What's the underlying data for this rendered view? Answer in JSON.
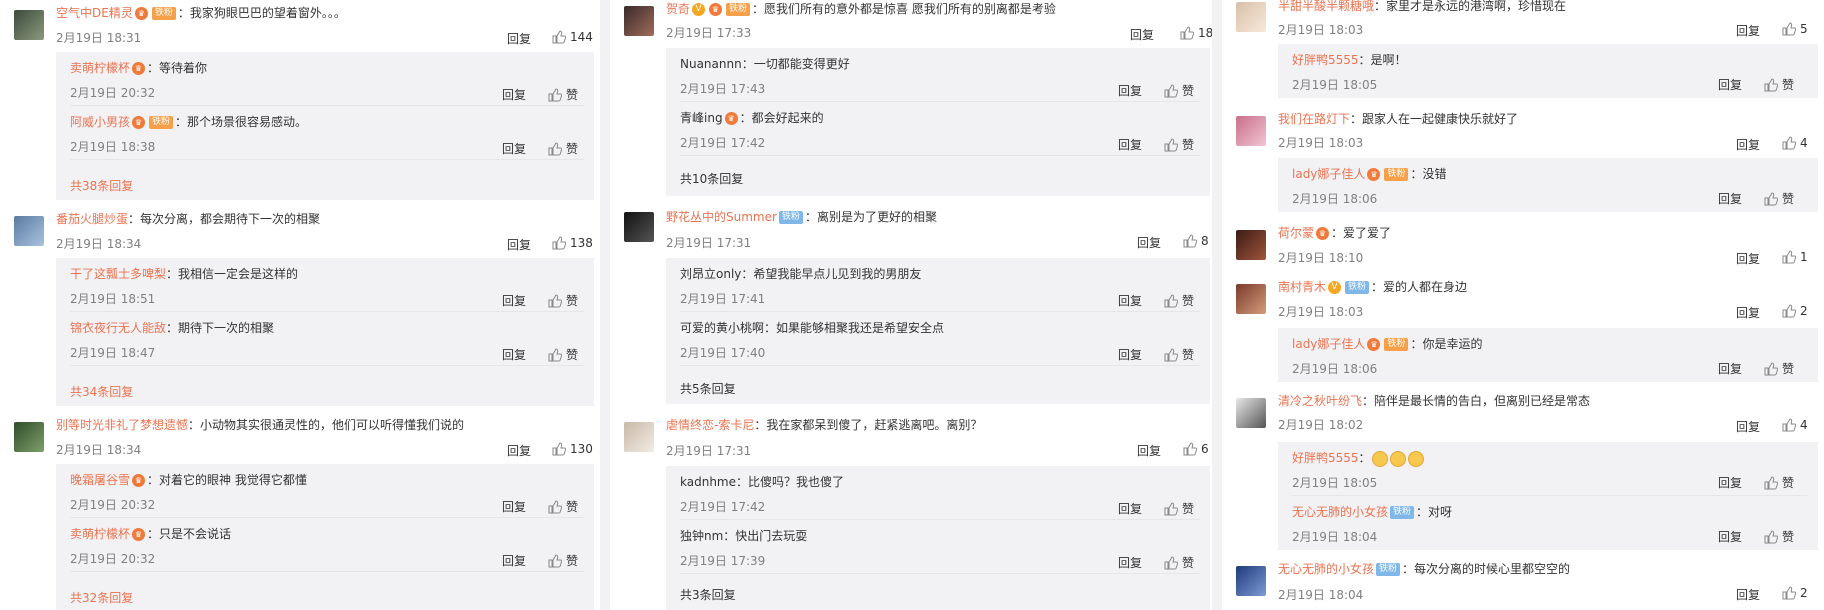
{
  "reply_label": "回复",
  "like_label": "赞",
  "colors": {
    "username": "#eb7350",
    "date": "#808080",
    "background": "#f2f2f5"
  },
  "icons": {
    "like": "thumbs-up-icon",
    "vip": "v-badge-icon",
    "fan": "fan-badge-icon"
  },
  "col1": {
    "c1": {
      "user": "空气中DE精灵",
      "badge": "铁粉",
      "text": "：我家狗眼巴巴的望着窗外。。。",
      "date": "2月19日 18:31",
      "likes": "144",
      "subs": [
        {
          "user": "卖萌柠檬杯",
          "text": "：等待着你",
          "date": "2月19日 20:32"
        },
        {
          "user": "阿威小男孩",
          "badge": "铁粉",
          "text": "：那个场景很容易感动。",
          "date": "2月19日 18:38"
        }
      ],
      "more": "共38条回复"
    },
    "c2": {
      "user": "番茄火腿炒蛋",
      "text": "：每次分离，都会期待下一次的相聚",
      "date": "2月19日 18:34",
      "likes": "138",
      "subs": [
        {
          "user": "干了这瓢士多啤梨",
          "text": "：我相信一定会是这样的",
          "date": "2月19日 18:51"
        },
        {
          "user": "锦衣夜行无人能敌",
          "text": "：期待下一次的相聚",
          "date": "2月19日 18:47"
        }
      ],
      "more": "共34条回复"
    },
    "c3": {
      "user": "别等时光非礼了梦想遗憾",
      "text": "：小动物其实很通灵性的，他们可以听得懂我们说的",
      "date": "2月19日 18:34",
      "likes": "130",
      "subs": [
        {
          "user": "晚霜屠谷雪",
          "text": "：对着它的眼神 我觉得它都懂",
          "date": "2月19日 20:32"
        },
        {
          "user": "卖萌柠檬杯",
          "text": "：只是不会说话",
          "date": "2月19日 20:32"
        }
      ],
      "more": "共32条回复"
    }
  },
  "col2": {
    "c1": {
      "user": "贺奇",
      "badge": "铁粉",
      "text": "：愿我们所有的意外都是惊喜  愿我们所有的别离都是考验",
      "date": "2月19日 17:33",
      "likes": "18",
      "subs": [
        {
          "user": "Nuanannn",
          "text": "：一切都能变得更好",
          "date": "2月19日 17:43"
        },
        {
          "user": "青峰ing",
          "text": "：都会好起来的",
          "date": "2月19日 17:42"
        }
      ],
      "more": "共10条回复"
    },
    "c2": {
      "user": "野花丛中的Summer",
      "badge": "铁粉",
      "text": "：离别是为了更好的相聚",
      "date": "2月19日 17:31",
      "likes": "8",
      "subs": [
        {
          "user": "刘昂立only",
          "text": "：希望我能早点儿见到我的男朋友",
          "date": "2月19日 17:41"
        },
        {
          "user": "可爱的黄小桃啊",
          "text": "：如果能够相聚我还是希望安全点",
          "date": "2月19日 17:40"
        }
      ],
      "more": "共5条回复"
    },
    "c3": {
      "user": "虐情终恋-索卡尼",
      "text": "：我在家都呆到傻了，赶紧逃离吧。离别？",
      "date": "2月19日 17:31",
      "likes": "6",
      "subs": [
        {
          "user": "kadnhme",
          "text": "：比傻吗？我也傻了",
          "date": "2月19日 17:42"
        },
        {
          "user": "独钟nm",
          "text": "：快出门去玩耍",
          "date": "2月19日 17:39"
        }
      ],
      "more": "共3条回复"
    }
  },
  "col3": {
    "c1": {
      "user": "半甜半酸半颗糖哦",
      "text": "：家里才是永远的港湾啊，珍惜现在",
      "date": "2月19日 18:03",
      "likes": "5",
      "subs": [
        {
          "user": "好胖鸭5555",
          "text": "：是啊！",
          "date": "2月19日 18:05"
        }
      ]
    },
    "c2": {
      "user": "我们在路灯下",
      "text": "：跟家人在一起健康快乐就好了",
      "date": "2月19日 18:03",
      "likes": "4",
      "subs": [
        {
          "user": "lady娜子佳人",
          "badge": "铁粉",
          "text": "：没错",
          "date": "2月19日 18:06"
        }
      ]
    },
    "c3": {
      "user": "荷尔蒙",
      "text": "：爱了爱了",
      "date": "2月19日 18:10",
      "likes": "1"
    },
    "c4": {
      "user": "南村青木",
      "badge": "铁粉",
      "text": "：爱的人都在身边",
      "date": "2月19日 18:03",
      "likes": "2",
      "subs": [
        {
          "user": "lady娜子佳人",
          "badge": "铁粉",
          "text": "：你是幸运的",
          "date": "2月19日 18:06"
        }
      ]
    },
    "c5": {
      "user": "清冷之秋叶纷飞",
      "text": "：陪伴是最长情的告白，但离别已经是常态",
      "date": "2月19日 18:02",
      "likes": "4",
      "subs": [
        {
          "user": "好胖鸭5555",
          "text": "：",
          "date": "2月19日 18:05"
        },
        {
          "user": "无心无肺的小女孩",
          "badge": "铁粉",
          "text": "：对呀",
          "date": "2月19日 18:04"
        }
      ]
    },
    "c6": {
      "user": "无心无肺的小女孩",
      "badge": "铁粉",
      "text": "：每次分离的时候心里都空空的",
      "date": "2月19日 18:04",
      "likes": "2"
    }
  }
}
